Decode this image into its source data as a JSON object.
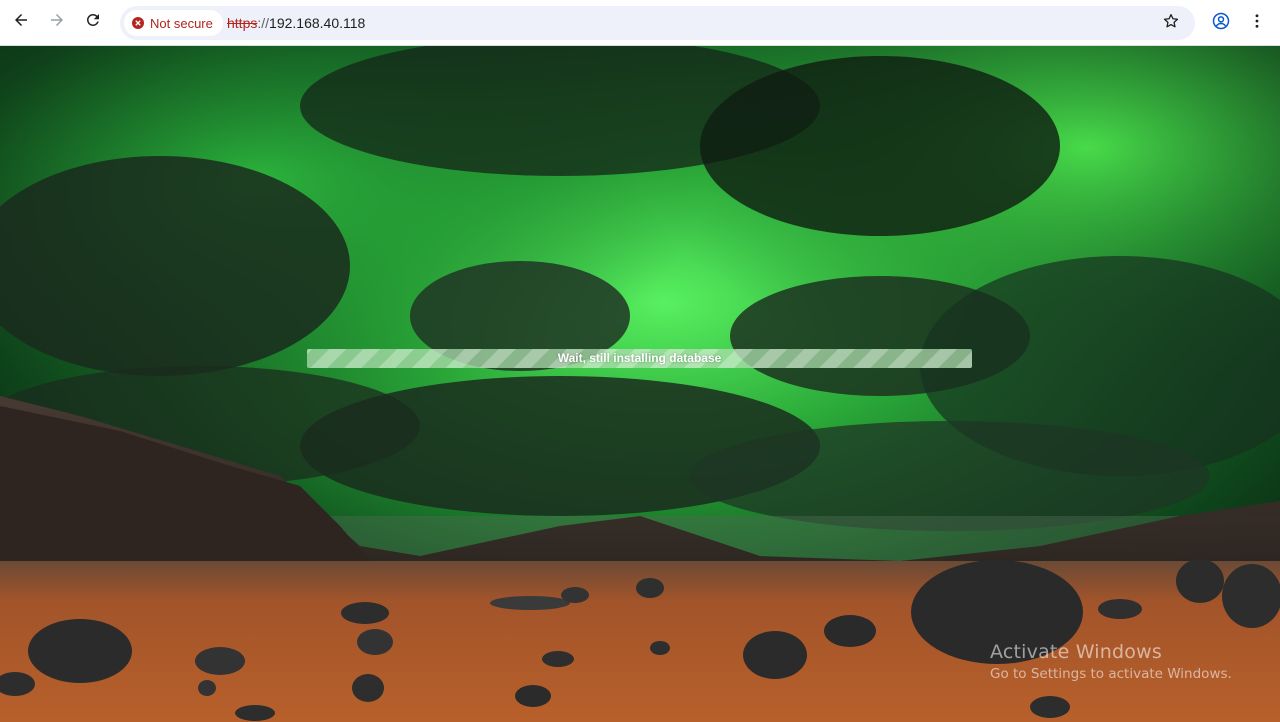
{
  "browser": {
    "security_label": "Not secure",
    "url_scheme": "https",
    "url_separator": "://",
    "url_host": "192.168.40.118"
  },
  "page": {
    "progress_text": "Wait, still installing database",
    "progress_fraction": 1.0
  },
  "watermark": {
    "title": "Activate Windows",
    "subtitle": "Go to Settings to activate Windows."
  },
  "icons": {
    "back": "arrow-left-icon",
    "forward": "arrow-right-icon",
    "reload": "reload-icon",
    "security": "warning-circle-icon",
    "bookmark": "star-icon",
    "profile": "account-icon",
    "menu": "more-vertical-icon"
  },
  "colors": {
    "security_red": "#b3261e",
    "omnibox_bg": "#eef1f9",
    "aurora_green": "#3fd84a",
    "desert_orange": "#b0501f"
  }
}
